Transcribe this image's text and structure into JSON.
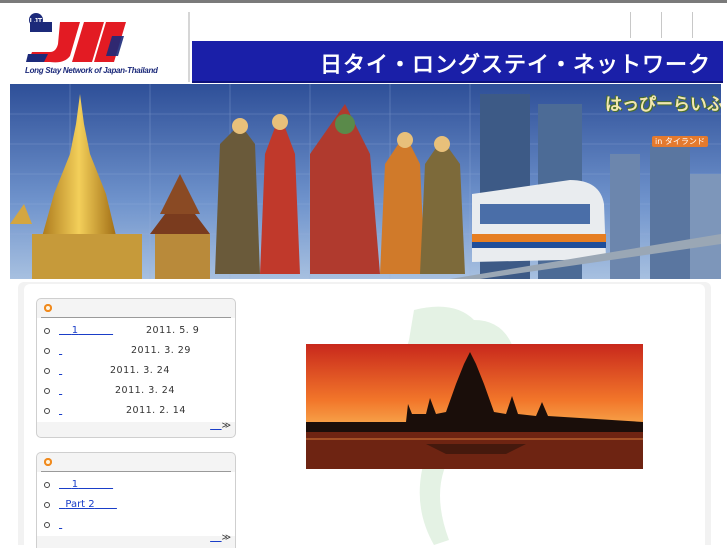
{
  "logo": {
    "mark": "LJT",
    "caption": "Long Stay Network of Japan-Thailand"
  },
  "header": {
    "title": "日タイ・ロングステイ・ネットワーク"
  },
  "banner": {
    "badge_main": "はっぴーらいふ",
    "badge_sub": "in タイランド"
  },
  "news": {
    "items": [
      {
        "link": "1",
        "date": "2011. 5. 9"
      },
      {
        "link": "",
        "date": "2011. 3. 29"
      },
      {
        "link": "",
        "date": "2011. 3. 24"
      },
      {
        "link": "",
        "date": "2011. 3. 24"
      },
      {
        "link": "",
        "date": "2011. 2. 14"
      }
    ],
    "more": "≫"
  },
  "box2": {
    "items": [
      {
        "link": "1"
      },
      {
        "link": "Part 2"
      },
      {
        "link": ""
      }
    ],
    "more": "≫"
  },
  "colors": {
    "title_bar": "#1a1fa8",
    "accent": "#f08a1e",
    "link": "#1a3ec8"
  },
  "icons": [
    "logo-mark-icon",
    "bullet-dot-icon",
    "more-arrow-icon",
    "thailand-map-icon"
  ]
}
